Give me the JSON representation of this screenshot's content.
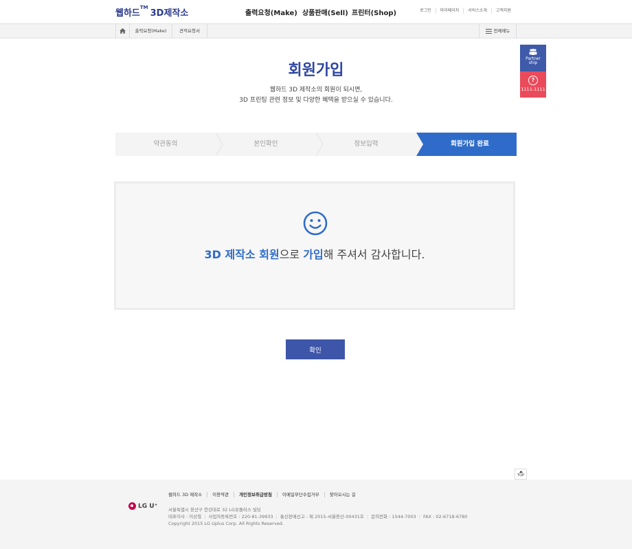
{
  "header": {
    "logo_text": "웹하드",
    "logo_tm": "TM",
    "logo_sub": "3D제작소",
    "nav": [
      "출력요청(Make)",
      "상품판매(Sell)",
      "프린터(Shop)"
    ],
    "util": [
      "로그인",
      "마이페이지",
      "서비스소개",
      "고객지원"
    ]
  },
  "subbar": {
    "crumbs": [
      "출력요청(Make)",
      "견적요청서"
    ],
    "all_menu": "전체메뉴"
  },
  "quick": {
    "partner": "Partner ship",
    "partner_l1": "Partner",
    "partner_l2": "ship",
    "call_icon": "?",
    "phone": "1111-1111"
  },
  "page": {
    "title": "회원가입",
    "desc_line1": "웹하드 3D  제작소의 회원이 되시면,",
    "desc_line2": "3D 프린팅 관련 정보 및 다양한 혜택을 받으실 수 있습니다."
  },
  "steps": [
    {
      "label": "약관동의",
      "active": false
    },
    {
      "label": "본인확인",
      "active": false
    },
    {
      "label": "정보입력",
      "active": false
    },
    {
      "label": "회원가입 완료",
      "active": true
    }
  ],
  "result": {
    "icon": "smile-icon",
    "part1": "3D 제작소 회원",
    "part2": "으로 ",
    "part3": "가입",
    "part4": "해 주셔서 감사합니다."
  },
  "confirm_label": "확인",
  "top_label": "TOP",
  "footer": {
    "logo_text": "LG U⁺",
    "links": [
      "웹하드 3D 제작소",
      "이용약관",
      "개인정보취급방침",
      "이메일무단수집거부",
      "찾아오시는 길"
    ],
    "address": "서울특별시 용산구 한강대로 32 LG유플러스 빌딩",
    "ceo": "대표이사 : 이상철",
    "biz_no": "사업자등록번호 : 220-81-39933",
    "mail_order": "통신판매신고 : 제 2015-서울용산-00431호",
    "phone": "문의전화 : 1544-7003",
    "fax": "FAX : 02-6718-6780",
    "copyright": "Copyright 2015 LG Uplus Corp. All Rights Reserved."
  },
  "colors": {
    "brand": "#2e46a0",
    "accent": "#2f6cc9",
    "button": "#3e56a9",
    "call": "#ea4b5b"
  }
}
